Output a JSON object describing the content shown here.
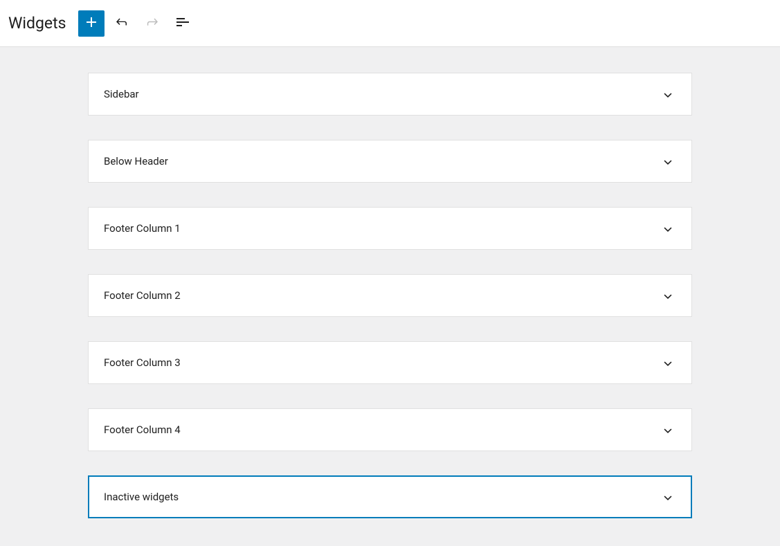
{
  "header": {
    "title": "Widgets"
  },
  "widgetAreas": [
    {
      "label": "Sidebar",
      "selected": false
    },
    {
      "label": "Below Header",
      "selected": false
    },
    {
      "label": "Footer Column 1",
      "selected": false
    },
    {
      "label": "Footer Column 2",
      "selected": false
    },
    {
      "label": "Footer Column 3",
      "selected": false
    },
    {
      "label": "Footer Column 4",
      "selected": false
    },
    {
      "label": "Inactive widgets",
      "selected": true
    }
  ]
}
